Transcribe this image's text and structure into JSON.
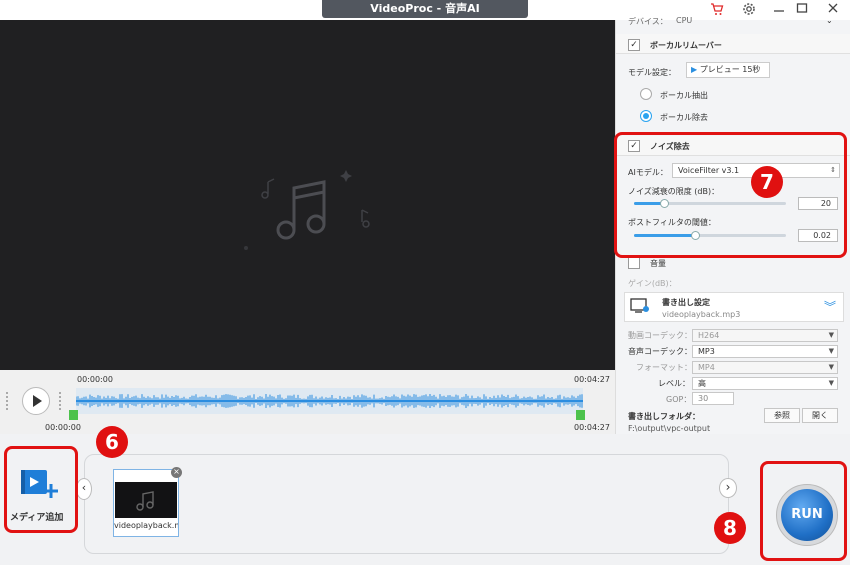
{
  "window": {
    "title": "VideoProc - 音声AI",
    "cart_icon": "cart-icon",
    "settings_icon": "gear-icon",
    "minimize_icon": "minimize-icon",
    "maximize_icon": "maximize-icon",
    "close_icon": "close-icon"
  },
  "timeline": {
    "start_top": "00:00:00",
    "end_top": "00:04:27",
    "start_bottom": "00:00:00",
    "end_bottom": "00:04:27"
  },
  "panel": {
    "device_label": "デバイス：",
    "device_value": "CPU",
    "vocal_remover": {
      "label": "ボーカルリムーバー",
      "checked": true,
      "model_label": "モデル設定：",
      "preview_button": "プレビュー 15秒",
      "options": [
        {
          "label": "ボーカル抽出",
          "selected": false
        },
        {
          "label": "ボーカル除去",
          "selected": true
        }
      ]
    },
    "noise": {
      "label": "ノイズ除去",
      "checked": true,
      "ai_model_label": "AIモデル：",
      "ai_model_value": "VoiceFilter v3.1",
      "limit_label": "ノイズ減衰の限度 (dB)：",
      "limit_value": "20",
      "limit_fraction": 0.2,
      "threshold_label": "ポストフィルタの閾値：",
      "threshold_value": "0.02",
      "threshold_fraction": 0.4
    },
    "volume_label": "音量",
    "gain_label": "ゲイン(dB)："
  },
  "export": {
    "title": "書き出し設定",
    "filename": "videoplayback.mp3",
    "rows": [
      {
        "label": "動画コーデック：",
        "value": "H264",
        "disabled": true
      },
      {
        "label": "音声コーデック：",
        "value": "MP3",
        "disabled": false
      },
      {
        "label": "フォーマット：",
        "value": "MP4",
        "disabled": true
      },
      {
        "label": "レベル：",
        "value": "高",
        "disabled": false
      }
    ],
    "gop_label": "GOP：",
    "gop_value": "30",
    "folder_label": "書き出しフォルダ：",
    "browse_button": "参照",
    "open_button": "開く",
    "folder_path": "F:\\output\\vpc-output"
  },
  "media": {
    "add_label": "メディア追加",
    "thumb_name": "videoplayback.mp",
    "run_label": "RUN"
  },
  "annotations": {
    "badge_6": "6",
    "badge_7": "7",
    "badge_8": "8"
  },
  "colors": {
    "accent": "#3a9de8",
    "red": "#e11212",
    "run_blue": "#1f6fc6"
  }
}
